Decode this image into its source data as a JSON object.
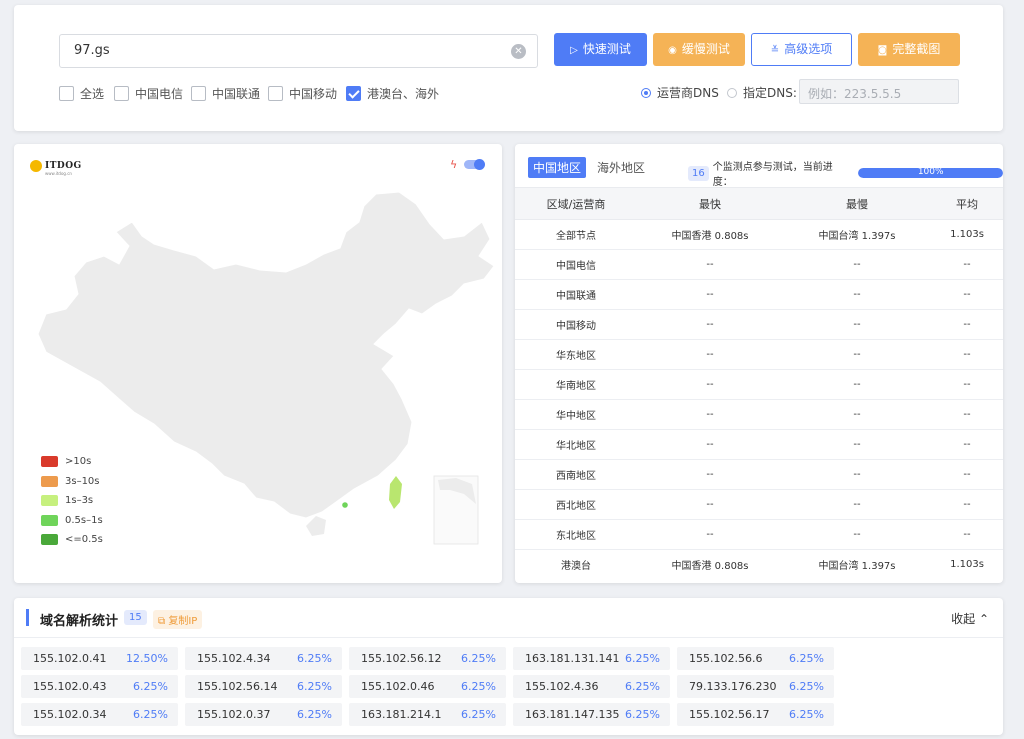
{
  "search": {
    "value": "97.gs",
    "placeholder": ""
  },
  "buttons": {
    "fast": "快速测试",
    "slow": "缓慢测试",
    "advanced": "高级选项",
    "screenshot": "完整截图"
  },
  "lines": [
    {
      "label": "全选",
      "checked": false
    },
    {
      "label": "中国电信",
      "checked": false
    },
    {
      "label": "中国联通",
      "checked": false
    },
    {
      "label": "中国移动",
      "checked": false
    },
    {
      "label": "港澳台、海外",
      "checked": true
    }
  ],
  "dns": {
    "isp_label": "运营商DNS",
    "custom_label": "指定DNS:",
    "selected": "isp",
    "input_placeholder": "例如：223.5.5.5"
  },
  "map": {
    "logo": "ITDOG",
    "logo_sub": "www.itdog.cn",
    "legend": [
      {
        "label": ">10s",
        "color": "#d93a2b"
      },
      {
        "label": "3s–10s",
        "color": "#ed9b4d"
      },
      {
        "label": "1s–3s",
        "color": "#c6f07e"
      },
      {
        "label": "0.5s–1s",
        "color": "#6fd45a"
      },
      {
        "label": "<=0.5s",
        "color": "#4aa83a"
      }
    ]
  },
  "stats": {
    "tabs": [
      "中国地区",
      "海外地区"
    ],
    "active_tab": 0,
    "node_count": "16",
    "progress_text": "个监测点参与测试，当前进度：",
    "progress": 100,
    "progress_label": "100%",
    "headers": [
      "区域/运营商",
      "最快",
      "最慢",
      "平均"
    ],
    "rows": [
      [
        "全部节点",
        "中国香港 0.808s",
        "中国台湾 1.397s",
        "1.103s"
      ],
      [
        "中国电信",
        "--",
        "--",
        "--"
      ],
      [
        "中国联通",
        "--",
        "--",
        "--"
      ],
      [
        "中国移动",
        "--",
        "--",
        "--"
      ],
      [
        "华东地区",
        "--",
        "--",
        "--"
      ],
      [
        "华南地区",
        "--",
        "--",
        "--"
      ],
      [
        "华中地区",
        "--",
        "--",
        "--"
      ],
      [
        "华北地区",
        "--",
        "--",
        "--"
      ],
      [
        "西南地区",
        "--",
        "--",
        "--"
      ],
      [
        "西北地区",
        "--",
        "--",
        "--"
      ],
      [
        "东北地区",
        "--",
        "--",
        "--"
      ],
      [
        "港澳台",
        "中国香港 0.808s",
        "中国台湾 1.397s",
        "1.103s"
      ]
    ]
  },
  "dns_stats": {
    "title": "域名解析统计",
    "count": "15",
    "copy_label": "复制IP",
    "collapse_label": "收起",
    "collapse_icon": "double-chevron-up-icon",
    "ips": [
      {
        "ip": "155.102.0.41",
        "pct": "12.50%"
      },
      {
        "ip": "155.102.4.34",
        "pct": "6.25%"
      },
      {
        "ip": "155.102.56.12",
        "pct": "6.25%"
      },
      {
        "ip": "163.181.131.141",
        "pct": "6.25%"
      },
      {
        "ip": "155.102.56.6",
        "pct": "6.25%"
      },
      {
        "ip": "155.102.0.43",
        "pct": "6.25%"
      },
      {
        "ip": "155.102.56.14",
        "pct": "6.25%"
      },
      {
        "ip": "155.102.0.46",
        "pct": "6.25%"
      },
      {
        "ip": "155.102.4.36",
        "pct": "6.25%"
      },
      {
        "ip": "79.133.176.230",
        "pct": "6.25%"
      },
      {
        "ip": "155.102.0.34",
        "pct": "6.25%"
      },
      {
        "ip": "155.102.0.37",
        "pct": "6.25%"
      },
      {
        "ip": "163.181.214.1",
        "pct": "6.25%"
      },
      {
        "ip": "163.181.147.135",
        "pct": "6.25%"
      },
      {
        "ip": "155.102.56.17",
        "pct": "6.25%"
      }
    ]
  },
  "colors": {
    "accent": "#4f7cf6",
    "orange": "#f5b356",
    "map_fill": "#ececec"
  }
}
